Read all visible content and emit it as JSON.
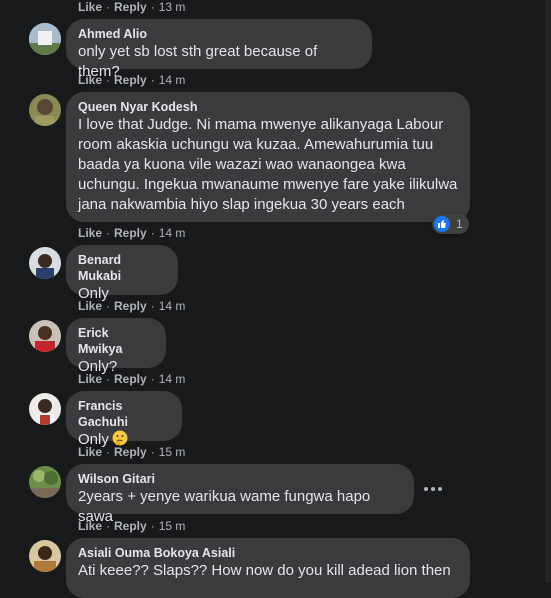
{
  "actions": {
    "like": "Like",
    "reply": "Reply",
    "separator": "·"
  },
  "comments": [
    {
      "name": "",
      "text": "",
      "time": "13 m"
    },
    {
      "name": "Ahmed Alio",
      "text": "only yet sb lost sth great because of them?",
      "time": "14 m"
    },
    {
      "name": "Queen Nyar Kodesh",
      "text": "I love that Judge. Ni mama mwenye alikanyaga Labour\nroom akaskia uchungu wa kuzaa. Amewahurumia tuu\nbaada ya kuona vile wazazi wao wanaongea kwa\nuchungu. Ingekua mwanaume mwenye fare yake ilikulwa\njana nakwambia hiyo slap ingekua 30 years each",
      "time": "14 m",
      "reaction_count": "1",
      "reaction_icon": "thumbs-up-icon"
    },
    {
      "name": "Benard Mukabi",
      "text": "Only",
      "time": "14 m"
    },
    {
      "name": "Erick Mwikya",
      "text": "Only?",
      "time": "14 m"
    },
    {
      "name": "Francis Gachuhi",
      "text": "Only",
      "emoji": "thinking-face-icon",
      "time": "15 m"
    },
    {
      "name": "Wilson Gitari",
      "text": "2years + yenye warikua wame fungwa hapo sawa",
      "time": "15 m"
    },
    {
      "name": "Asiali Ouma Bokoya Asiali",
      "text": "Ati keee?? Slaps?? How now do you kill adead lion then"
    }
  ],
  "colors": {
    "background": "#18191a",
    "bubble": "#3a3b3c",
    "text": "#e4e6eb",
    "meta": "#b0b3b8",
    "like_blue": "#1877f2"
  }
}
